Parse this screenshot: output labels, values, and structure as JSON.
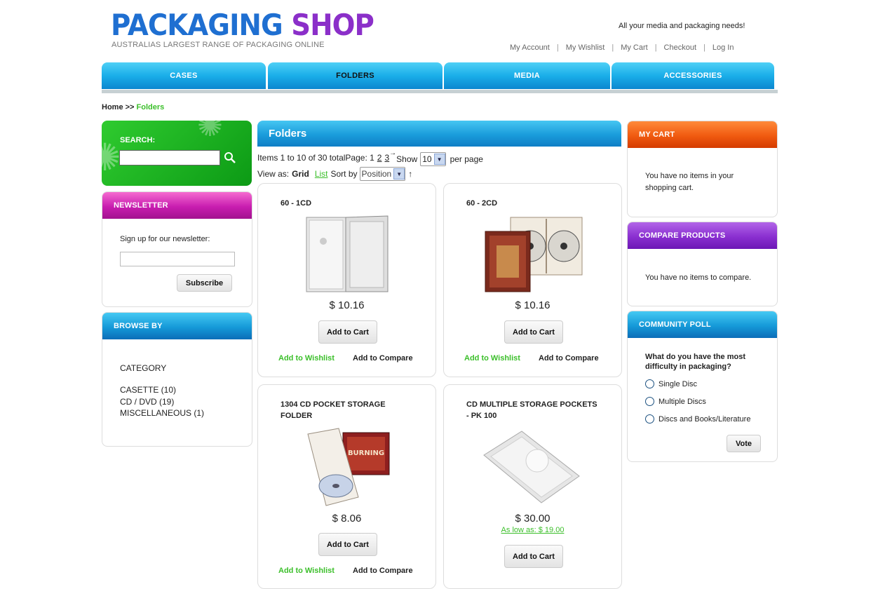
{
  "header": {
    "logo_part1": "PACKAGING",
    "logo_part2": "SHOP",
    "logo_sub": "AUSTRALIAS LARGEST RANGE OF PACKAGING ONLINE",
    "tagline": "All your media and packaging needs!",
    "links": [
      "My Account",
      "My Wishlist",
      "My Cart",
      "Checkout",
      "Log In"
    ]
  },
  "nav": [
    "CASES",
    "FOLDERS",
    "MEDIA",
    "ACCESSORIES"
  ],
  "breadcrumb": {
    "home": "Home",
    "sep": ">>",
    "current": "Folders"
  },
  "search": {
    "label": "SEARCH:",
    "placeholder": ""
  },
  "newsletter": {
    "title": "NEWSLETTER",
    "text": "Sign up for our newsletter:",
    "button": "Subscribe"
  },
  "browse": {
    "title": "BROWSE BY",
    "heading": "CATEGORY",
    "items": [
      "CASETTE (10)",
      "CD / DVD (19)",
      "MISCELLANEOUS (1)"
    ]
  },
  "main": {
    "title": "Folders",
    "items_text": "Items 1 to 10 of 30 total",
    "page_label": "Page: 1",
    "pages": [
      "2",
      "3"
    ],
    "next_arrow": "→",
    "show_label": "Show",
    "show_value": "10",
    "per_page": "per page",
    "view_as": "View as:",
    "grid": "Grid",
    "list": "List",
    "sort_by": "Sort by",
    "sort_value": "Position",
    "sort_arrow": "↑"
  },
  "products": [
    {
      "name": "60 - 1CD",
      "price": "$ 10.16",
      "cart": "Add to Cart",
      "wishlist": "Add to Wishlist",
      "compare": "Add to Compare"
    },
    {
      "name": "60 - 2CD",
      "price": "$ 10.16",
      "cart": "Add to Cart",
      "wishlist": "Add to Wishlist",
      "compare": "Add to Compare"
    },
    {
      "name": "1304 CD POCKET STORAGE FOLDER",
      "price": "$ 8.06",
      "cart": "Add to Cart",
      "wishlist": "Add to Wishlist",
      "compare": "Add to Compare"
    },
    {
      "name": "CD MULTIPLE STORAGE POCKETS - PK 100",
      "price": "$ 30.00",
      "as_low": "As low as: $ 19.00",
      "cart": "Add to Cart"
    }
  ],
  "cart": {
    "title": "MY CART",
    "text": "You have no items in your shopping cart."
  },
  "compare": {
    "title": "COMPARE PRODUCTS",
    "text": "You have no items to compare."
  },
  "poll": {
    "title": "COMMUNITY POLL",
    "question": "What do you have the most difficulty in packaging?",
    "options": [
      "Single Disc",
      "Multiple Discs",
      "Discs and Books/Literature"
    ],
    "button": "Vote"
  },
  "colors": {
    "accent_green": "#3bbf2a",
    "nav_blue": "#1aaee9",
    "logo_blue": "#1f6fd1",
    "logo_purple": "#8b2fc9"
  }
}
